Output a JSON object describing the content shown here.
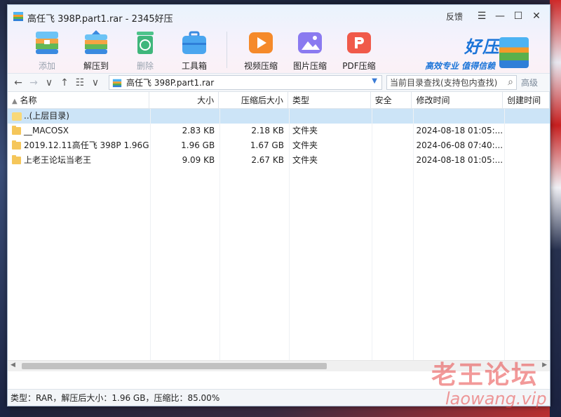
{
  "window": {
    "title": "高任飞 398P.part1.rar - 2345好压"
  },
  "controls": {
    "feedback": "反馈",
    "menu": "☰",
    "minimize": "—",
    "maximize": "☐",
    "close": "✕"
  },
  "toolbar": {
    "add": "添加",
    "extract": "解压到",
    "delete": "删除",
    "toolbox": "工具箱",
    "video": "视频压缩",
    "image": "图片压缩",
    "pdf": "PDF压缩"
  },
  "brand": {
    "name": "好压",
    "slogan": "高效专业  值得信赖"
  },
  "nav": {
    "path": "高任飞 398P.part1.rar",
    "search_placeholder": "当前目录查找(支持包内查找)",
    "advanced": "高级"
  },
  "columns": [
    "名称",
    "大小",
    "压缩后大小",
    "类型",
    "安全",
    "修改时间",
    "创建时间"
  ],
  "parent_row": "..(上层目录)",
  "rows": [
    {
      "name": "__MACOSX",
      "size": "2.83 KB",
      "packed": "2.18 KB",
      "type": "文件夹",
      "security": "",
      "modified": "2024-08-18 01:05:...",
      "created": ""
    },
    {
      "name": "2019.12.11高任飞 398P 1.96G",
      "size": "1.96 GB",
      "packed": "1.67 GB",
      "type": "文件夹",
      "security": "",
      "modified": "2024-06-08 07:40:...",
      "created": ""
    },
    {
      "name": "上老王论坛当老王",
      "size": "9.09 KB",
      "packed": "2.67 KB",
      "type": "文件夹",
      "security": "",
      "modified": "2024-08-18 01:05:...",
      "created": ""
    }
  ],
  "status": "类型：RAR，解压后大小：1.96 GB，压缩比：85.00%",
  "watermark": {
    "line1": "老王论坛",
    "line2": "laowang.vip"
  }
}
